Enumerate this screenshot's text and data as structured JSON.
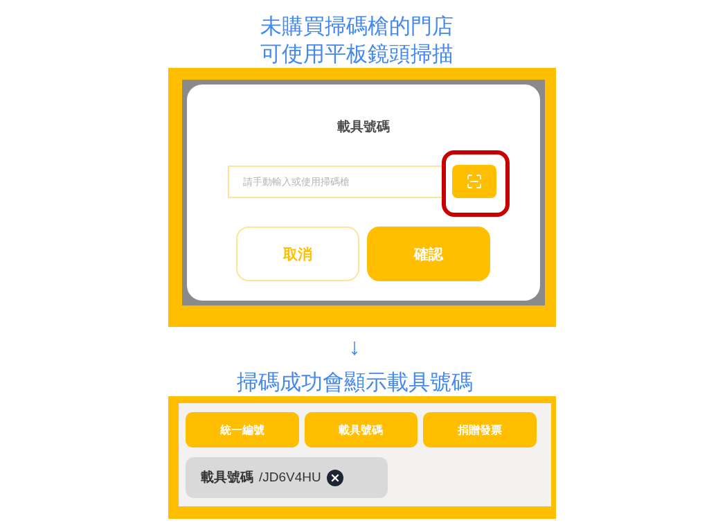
{
  "top_caption": {
    "lines": [
      "未購買掃碼槍的門店",
      "可使用平板鏡頭掃描"
    ]
  },
  "dialog": {
    "title": "載具號碼",
    "input": {
      "placeholder": "請手動輸入或使用掃碼槍"
    },
    "scan_button": {
      "highlighted": true
    },
    "buttons": [
      {
        "label": "取消",
        "kind": "outline"
      },
      {
        "label": "確認",
        "kind": "filled"
      }
    ]
  },
  "arrow": "↓",
  "bottom_caption": "掃碼成功會顯示載具號碼",
  "invoice_panel": {
    "options": [
      {
        "label": "統一編號"
      },
      {
        "label": "載具號碼"
      },
      {
        "label": "捐贈發票"
      }
    ],
    "chip": {
      "label": "載具號碼",
      "value": "/JD6V4HU"
    }
  }
}
